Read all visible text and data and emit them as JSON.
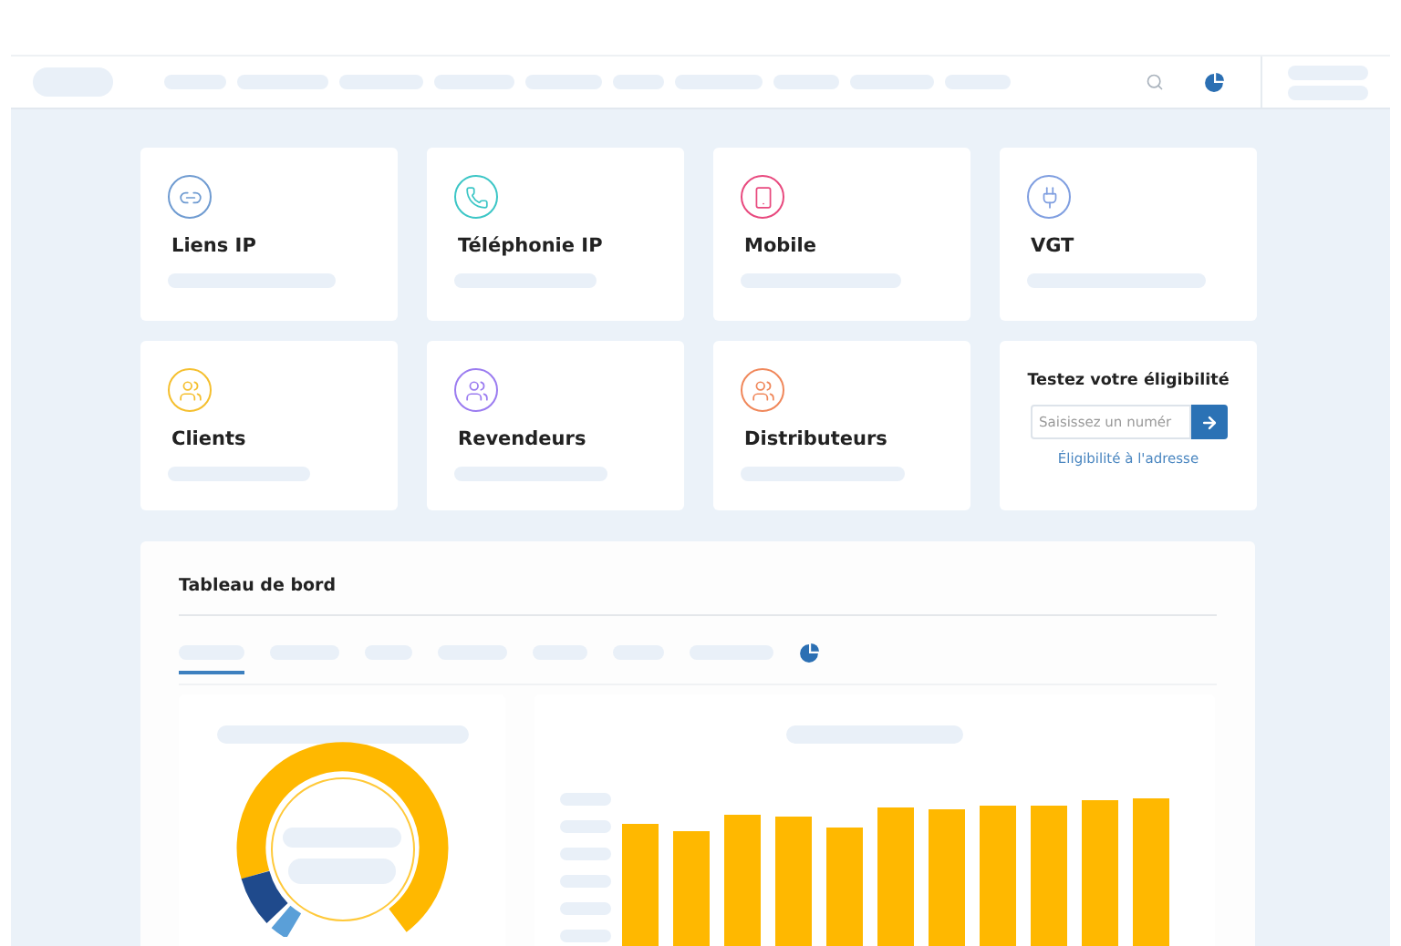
{
  "cards": [
    {
      "kind": "service",
      "label": "Liens IP",
      "color": "#6f9bd1"
    },
    {
      "kind": "service",
      "label": "Téléphonie IP",
      "color": "#3cc6c6"
    },
    {
      "kind": "service",
      "label": "Mobile",
      "color": "#e8497e"
    },
    {
      "kind": "service",
      "label": "VGT",
      "color": "#7f9ee0"
    },
    {
      "kind": "service",
      "label": "Clients",
      "color": "#f5bf2e"
    },
    {
      "kind": "service",
      "label": "Revendeurs",
      "color": "#9b7cf0"
    },
    {
      "kind": "service",
      "label": "Distributeurs",
      "color": "#f0875a"
    },
    {
      "kind": "eligibility",
      "title": "Testez votre éligibilité",
      "placeholder": "Saisissez un numér",
      "link": "Éligibilité à l'adresse"
    }
  ],
  "dashboard": {
    "title": "Tableau de bord",
    "tabs": [
      {
        "selected": true
      },
      {
        "selected": false
      },
      {
        "selected": false
      },
      {
        "selected": false
      },
      {
        "selected": false
      },
      {
        "selected": false
      },
      {
        "selected": false
      }
    ]
  }
}
